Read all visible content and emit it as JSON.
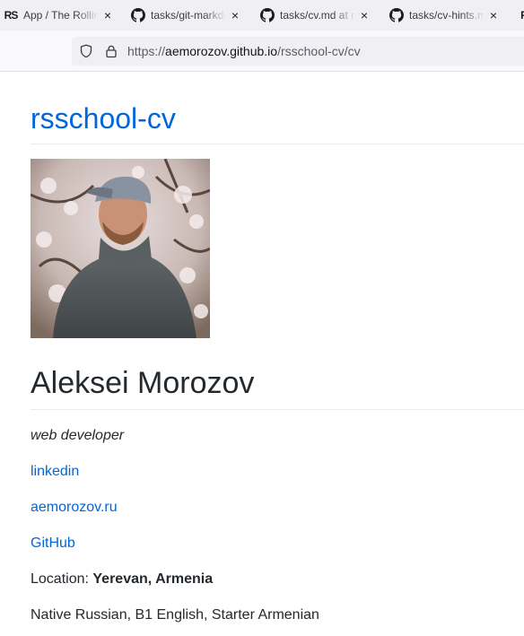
{
  "browser": {
    "tabs": [
      {
        "title": "App / The Rolling",
        "icon": "rs-logo",
        "favicon_text": "RS"
      },
      {
        "title": "tasks/git-markdo",
        "icon": "github-icon"
      },
      {
        "title": "tasks/cv.md at m",
        "icon": "github-icon"
      },
      {
        "title": "tasks/cv-hints.m",
        "icon": "github-icon"
      },
      {
        "title": "",
        "icon": "rs-logo",
        "favicon_text": "R"
      }
    ],
    "url": {
      "scheme": "https://",
      "host": "aemorozov.github.io",
      "path": "/rsschool-cv/cv"
    }
  },
  "page": {
    "site_title": "rsschool-cv",
    "name": "Aleksei Morozov",
    "role": "web developer",
    "links": {
      "linkedin": "linkedin",
      "website": "aemorozov.ru",
      "github": "GitHub"
    },
    "location_label": "Location: ",
    "location_value": "Yerevan, Armenia",
    "languages": "Native Russian, B1 English, Starter Armenian"
  },
  "colors": {
    "link": "#0366d6",
    "text": "#24292e",
    "tabbar_bg": "#f0f0f4"
  }
}
